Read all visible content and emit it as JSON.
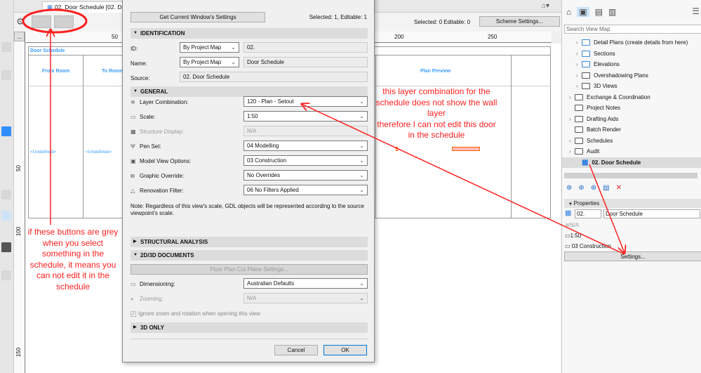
{
  "tab": {
    "title": "02. Door Schedule [02. Do"
  },
  "toolbar": {
    "status": "Selected: 0  Editable: 0",
    "scheme_button": "Scheme Settings...",
    "more_button": "..."
  },
  "ruler": {
    "h_labels": [
      "50",
      "200",
      "250"
    ],
    "v_labels": [
      "50",
      "100",
      "150"
    ]
  },
  "schedule": {
    "title": "Door Schedule",
    "columns": [
      "From Room",
      "To Room",
      "Plan Preview"
    ],
    "row": [
      "<Undefined>",
      "<Undefined>"
    ]
  },
  "dialog": {
    "get_settings_button": "Get Current Window's Settings",
    "status": "Selected: 1, Editable: 1",
    "identification": {
      "header": "IDENTIFICATION",
      "id_label": "ID:",
      "id_mode": "By Project Map",
      "id_value": "02.",
      "name_label": "Name:",
      "name_mode": "By Project Map",
      "name_value": "Door Schedule",
      "source_label": "Source:",
      "source_value": "02. Door Schedule"
    },
    "general": {
      "header": "GENERAL",
      "rows": [
        {
          "label": "Layer Combination:",
          "value": "120 - Plan - Setout",
          "disabled": false
        },
        {
          "label": "Scale:",
          "value": "1:50",
          "disabled": false
        },
        {
          "label": "Structure Display:",
          "value": "N/A",
          "disabled": true
        },
        {
          "label": "Pen Set:",
          "value": "04 Modelling",
          "disabled": false
        },
        {
          "label": "Model View Options:",
          "value": "03 Construction",
          "disabled": false
        },
        {
          "label": "Graphic Override:",
          "value": "No Overrides",
          "disabled": false
        },
        {
          "label": "Renovation Filter:",
          "value": "06 No Filters Applied",
          "disabled": false
        }
      ],
      "note": "Note: Regardless of this view's scale, GDL objects will be represented according to the source viewpoint's scale."
    },
    "structural_header": "STRUCTURAL ANALYSIS",
    "docs": {
      "header": "2D/3D DOCUMENTS",
      "cut_plane_button": "Floor Plan Cut Plane Settings...",
      "dim_label": "Dimensioning:",
      "dim_value": "Australian Defaults",
      "zoom_label": "Zooming:",
      "zoom_value": "N/A",
      "ignore_label": "Ignore zoom and rotation when opening this view",
      "ignore_checked": true
    },
    "only3d_header": "3D ONLY",
    "cancel": "Cancel",
    "ok": "OK"
  },
  "navigator": {
    "search_placeholder": "Search View Map",
    "items": [
      {
        "label": "Detail Plans (create details from here)",
        "indent": 1,
        "arrow": true
      },
      {
        "label": "Sections",
        "indent": 1,
        "arrow": true
      },
      {
        "label": "Elevations",
        "indent": 1,
        "arrow": true
      },
      {
        "label": "Overshadowing Plans",
        "indent": 1,
        "arrow": true
      },
      {
        "label": "3D Views",
        "indent": 1,
        "arrow": true
      },
      {
        "label": "Exchange & Coordination",
        "indent": 0,
        "arrow": true
      },
      {
        "label": "Project Notes",
        "indent": 0,
        "arrow": false
      },
      {
        "label": "Drafting Aids",
        "indent": 0,
        "arrow": true
      },
      {
        "label": "Batch Render",
        "indent": 0,
        "arrow": false
      },
      {
        "label": "Schedules",
        "indent": 0,
        "arrow": true
      },
      {
        "label": "Audit",
        "indent": 0,
        "arrow": true
      },
      {
        "label": "02. Door Schedule",
        "indent": 1,
        "arrow": false,
        "selected": true
      }
    ],
    "properties": {
      "header": "Properties",
      "id": "02.",
      "name": "Door Schedule",
      "layer": "N/A",
      "scale": "1:50",
      "mvo": "03 Construction",
      "settings_button": "Settings..."
    }
  },
  "annotations": {
    "left": "if these buttons are grey when you select something in the schedule, it means you can not edit it in the schedule",
    "right1": "this layer combination for the schedule does not show the wall layer",
    "right2": "therefore I can not edit this door in the schedule",
    "color": "#ff2020"
  }
}
